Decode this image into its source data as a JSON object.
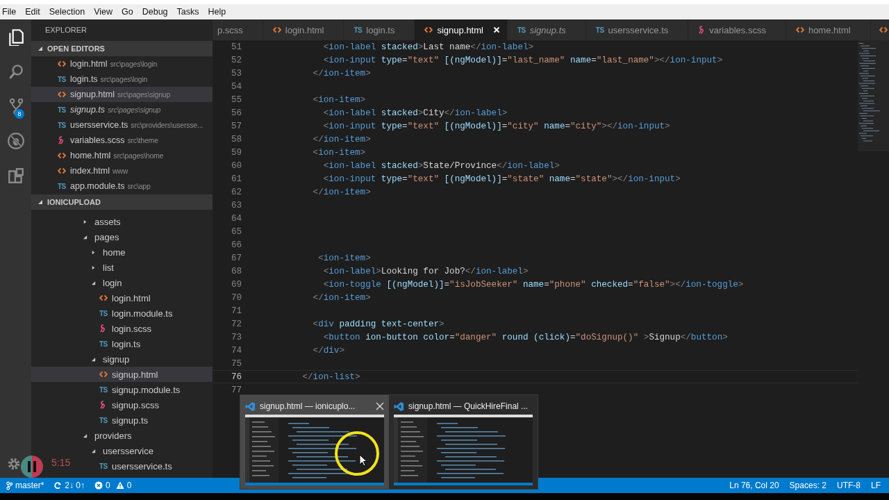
{
  "menu": [
    "File",
    "Edit",
    "Selection",
    "View",
    "Go",
    "Debug",
    "Tasks",
    "Help"
  ],
  "activity_bar": [
    {
      "kind": "explorer",
      "selected": true
    },
    {
      "kind": "search",
      "selected": false
    },
    {
      "kind": "git",
      "selected": false,
      "badge": "8"
    },
    {
      "kind": "debug",
      "selected": false
    },
    {
      "kind": "extensions",
      "selected": false
    }
  ],
  "recorder_timer": "5:15",
  "sidebar": {
    "title": "EXPLORER",
    "open_editors": {
      "title": "OPEN EDITORS",
      "expanded": true,
      "items": [
        {
          "name": "login.html",
          "path": "src\\pages\\login",
          "kind": "html",
          "selected": false,
          "preview": false
        },
        {
          "name": "login.ts",
          "path": "src\\pages\\login",
          "kind": "ts",
          "icon_label": "TS",
          "selected": false,
          "preview": false
        },
        {
          "name": "signup.html",
          "path": "src\\pages\\signup",
          "kind": "html",
          "selected": true,
          "preview": false
        },
        {
          "name": "signup.ts",
          "path": "src\\pages\\signup",
          "kind": "ts",
          "icon_label": "TS",
          "selected": false,
          "preview": true
        },
        {
          "name": "usersservice.ts",
          "path": "src\\providers\\usersse...",
          "kind": "ts",
          "icon_label": "TS",
          "selected": false,
          "preview": false
        },
        {
          "name": "variables.scss",
          "path": "src\\theme",
          "kind": "scss",
          "selected": false,
          "preview": false
        },
        {
          "name": "home.html",
          "path": "src\\pages\\home",
          "kind": "html",
          "selected": false,
          "preview": false
        },
        {
          "name": "index.html",
          "path": "www",
          "kind": "html",
          "selected": false,
          "preview": false
        },
        {
          "name": "app.module.ts",
          "path": "src\\app",
          "kind": "ts",
          "icon_label": "TS",
          "selected": false,
          "preview": false
        }
      ]
    },
    "project": {
      "title": "IONICUPLOAD",
      "expanded": true,
      "tree": [
        {
          "name": "assets",
          "kind": "folder",
          "expanded": false,
          "selected": false
        },
        {
          "name": "pages",
          "kind": "folder",
          "expanded": true,
          "selected": false,
          "children": [
            {
              "name": "home",
              "kind": "folder",
              "expanded": false,
              "selected": false
            },
            {
              "name": "list",
              "kind": "folder",
              "expanded": false,
              "selected": false
            },
            {
              "name": "login",
              "kind": "folder",
              "expanded": true,
              "selected": false,
              "children": [
                {
                  "name": "login.html",
                  "kind": "html",
                  "selected": false
                },
                {
                  "name": "login.module.ts",
                  "kind": "ts",
                  "icon_label": "TS",
                  "selected": false
                },
                {
                  "name": "login.scss",
                  "kind": "scss",
                  "selected": false
                },
                {
                  "name": "login.ts",
                  "kind": "ts",
                  "icon_label": "TS",
                  "selected": false
                }
              ]
            },
            {
              "name": "signup",
              "kind": "folder",
              "expanded": true,
              "selected": false,
              "children": [
                {
                  "name": "signup.html",
                  "kind": "html",
                  "selected": true
                },
                {
                  "name": "signup.module.ts",
                  "kind": "ts",
                  "icon_label": "TS",
                  "selected": false
                },
                {
                  "name": "signup.scss",
                  "kind": "scss",
                  "selected": false
                },
                {
                  "name": "signup.ts",
                  "kind": "ts",
                  "icon_label": "TS",
                  "selected": false
                }
              ]
            }
          ]
        },
        {
          "name": "providers",
          "kind": "folder",
          "expanded": true,
          "selected": false,
          "children": [
            {
              "name": "usersservice",
              "kind": "folder",
              "expanded": true,
              "selected": false,
              "children": [
                {
                  "name": "usersservice.ts",
                  "kind": "ts",
                  "icon_label": "TS",
                  "selected": false
                }
              ]
            }
          ]
        }
      ]
    }
  },
  "tabs": [
    {
      "label": "p.scss",
      "selected": false,
      "preview": false
    },
    {
      "label": "login.html",
      "kind": "html",
      "selected": false,
      "preview": false
    },
    {
      "label": "login.ts",
      "kind": "ts",
      "icon_label": "TS",
      "selected": false,
      "preview": false
    },
    {
      "label": "signup.html",
      "kind": "html",
      "selected": true,
      "preview": false
    },
    {
      "label": "signup.ts",
      "kind": "ts",
      "icon_label": "TS",
      "selected": false,
      "preview": true
    },
    {
      "label": "usersservice.ts",
      "kind": "ts",
      "icon_label": "TS",
      "selected": false,
      "preview": false
    },
    {
      "label": "variables.scss",
      "kind": "scss",
      "selected": false,
      "preview": false
    },
    {
      "label": "home.html",
      "kind": "html",
      "selected": false,
      "preview": false
    },
    {
      "kind": "html",
      "selected": false
    }
  ],
  "editor": {
    "lines": [
      {
        "number": "51",
        "code": "            <ion-label stacked>Last name</ion-label>",
        "current": false
      },
      {
        "number": "52",
        "code": "            <ion-input type=\"text\" [(ngModel)]=\"last_name\" name=\"last_name\"></ion-input>",
        "current": false
      },
      {
        "number": "53",
        "code": "          </ion-item>",
        "current": false
      },
      {
        "number": "54",
        "current": false
      },
      {
        "number": "55",
        "code": "          <ion-item>",
        "current": false
      },
      {
        "number": "56",
        "code": "            <ion-label stacked>City</ion-label>",
        "current": false
      },
      {
        "number": "57",
        "code": "            <ion-input type=\"text\" [(ngModel)]=\"city\" name=\"city\"></ion-input>",
        "current": false
      },
      {
        "number": "58",
        "code": "          </ion-item>",
        "current": false
      },
      {
        "number": "59",
        "code": "          <ion-item>",
        "current": false
      },
      {
        "number": "60",
        "code": "            <ion-label stacked>State/Province</ion-label>",
        "current": false
      },
      {
        "number": "61",
        "code": "            <ion-input type=\"text\" [(ngModel)]=\"state\" name=\"state\"></ion-input>",
        "current": false
      },
      {
        "number": "62",
        "code": "          </ion-item>",
        "current": false
      },
      {
        "number": "63",
        "current": false
      },
      {
        "number": "64",
        "current": false
      },
      {
        "number": "65",
        "current": false
      },
      {
        "number": "66",
        "current": false
      },
      {
        "number": "67",
        "code": "           <ion-item>",
        "current": false
      },
      {
        "number": "68",
        "code": "            <ion-label>Looking for Job?</ion-label>",
        "current": false
      },
      {
        "number": "69",
        "code": "            <ion-toggle [(ngModel)]=\"isJobSeeker\" name=\"phone\" checked=\"false\"></ion-toggle>",
        "current": false
      },
      {
        "number": "70",
        "code": "          </ion-item>",
        "current": false
      },
      {
        "number": "71",
        "current": false
      },
      {
        "number": "72",
        "code": "          <div padding text-center>",
        "current": false
      },
      {
        "number": "73",
        "code": "            <button ion-button color=\"danger\" round (click)=\"doSignup()\" >Signup</button>",
        "current": false
      },
      {
        "number": "74",
        "code": "          </div>",
        "current": false
      },
      {
        "number": "75",
        "current": false
      },
      {
        "number": "76",
        "code": "        </ion-list>",
        "current": true
      },
      {
        "number": "77",
        "current": false
      }
    ]
  },
  "taskbar_previews": [
    {
      "title": "signup.html — ionicuplo...",
      "hovered": true
    },
    {
      "title": "signup.html — QuickHireFinal ...",
      "hovered": false
    }
  ],
  "status_bar": {
    "branch": "master*",
    "sync": "2↓ 0↑",
    "errors": "0",
    "warnings": "0",
    "position": "Ln 76, Col 20",
    "indentation": "Spaces: 2",
    "encoding": "UTF-8",
    "eol": "LF"
  }
}
